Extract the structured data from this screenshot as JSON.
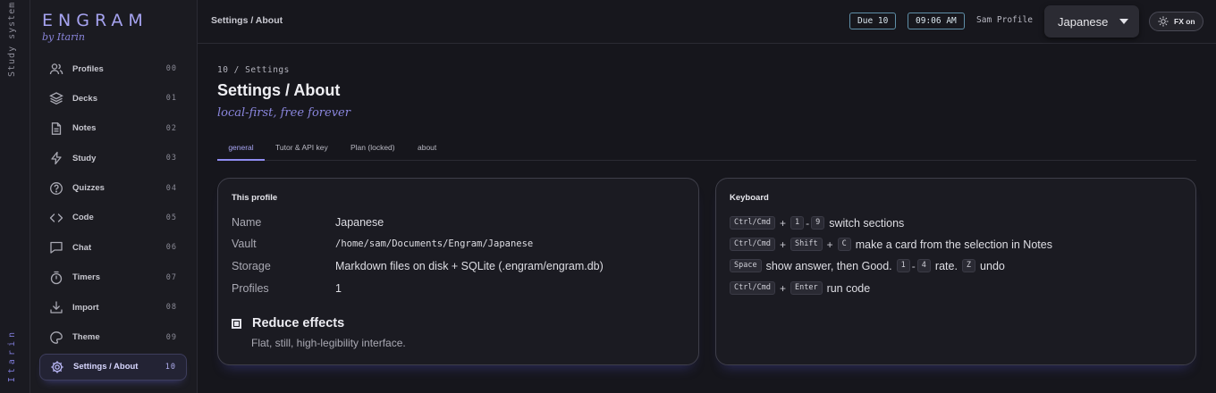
{
  "rail": {
    "top_label": "Study system",
    "bottom_label": "Itarin"
  },
  "brand": {
    "title": "ENGRAM",
    "subtitle": "by Itarin"
  },
  "nav": [
    {
      "label": "Profiles",
      "num": "00",
      "icon": "users-icon"
    },
    {
      "label": "Decks",
      "num": "01",
      "icon": "layers-icon"
    },
    {
      "label": "Notes",
      "num": "02",
      "icon": "note-icon"
    },
    {
      "label": "Study",
      "num": "03",
      "icon": "bolt-icon"
    },
    {
      "label": "Quizzes",
      "num": "04",
      "icon": "question-icon"
    },
    {
      "label": "Code",
      "num": "05",
      "icon": "code-icon"
    },
    {
      "label": "Chat",
      "num": "06",
      "icon": "chat-icon"
    },
    {
      "label": "Timers",
      "num": "07",
      "icon": "timer-icon"
    },
    {
      "label": "Import",
      "num": "08",
      "icon": "download-icon"
    },
    {
      "label": "Theme",
      "num": "09",
      "icon": "palette-icon"
    },
    {
      "label": "Settings / About",
      "num": "10",
      "icon": "gear-icon",
      "active": true
    }
  ],
  "header": {
    "breadcrumb": "Settings / About",
    "due": "Due 10",
    "time": "09:06 AM",
    "profile_label": "Sam Profile",
    "language": "Japanese",
    "fx": "FX on"
  },
  "main": {
    "eyebrow": "10 / Settings",
    "title": "Settings / About",
    "subtitle": "local-first, free forever",
    "tabs": [
      {
        "label": "general",
        "active": true
      },
      {
        "label": "Tutor & API key"
      },
      {
        "label": "Plan (locked)"
      },
      {
        "label": "about"
      }
    ]
  },
  "profile_card": {
    "title": "This profile",
    "rows": [
      {
        "key": "Name",
        "value": "Japanese"
      },
      {
        "key": "Vault",
        "value": "/home/sam/Documents/Engram/Japanese"
      },
      {
        "key": "Storage",
        "value": "Markdown files on disk + SQLite (.engram/engram.db)"
      },
      {
        "key": "Profiles",
        "value": "1"
      }
    ],
    "reduce_effects": {
      "label": "Reduce effects",
      "description": "Flat, still, high-legibility interface.",
      "checked": true
    }
  },
  "keyboard_card": {
    "title": "Keyboard",
    "rows": [
      {
        "keys": [
          "Ctrl/Cmd",
          "+",
          "1",
          "-",
          "9"
        ],
        "text": "switch sections"
      },
      {
        "keys": [
          "Ctrl/Cmd",
          "+",
          "Shift",
          "+",
          "C"
        ],
        "text": "make a card from the selection in Notes"
      },
      {
        "keys": [
          "Space"
        ],
        "text1": "show answer, then Good.",
        "keys2": [
          "1",
          "-",
          "4"
        ],
        "text2": "rate.",
        "keys3": [
          "Z"
        ],
        "text3": "undo"
      },
      {
        "keys": [
          "Ctrl/Cmd",
          "+",
          "Enter"
        ],
        "text": "run code"
      }
    ]
  },
  "colors": {
    "accent": "#8f8cf0",
    "background": "#16161c",
    "panel": "#1b1b22"
  }
}
